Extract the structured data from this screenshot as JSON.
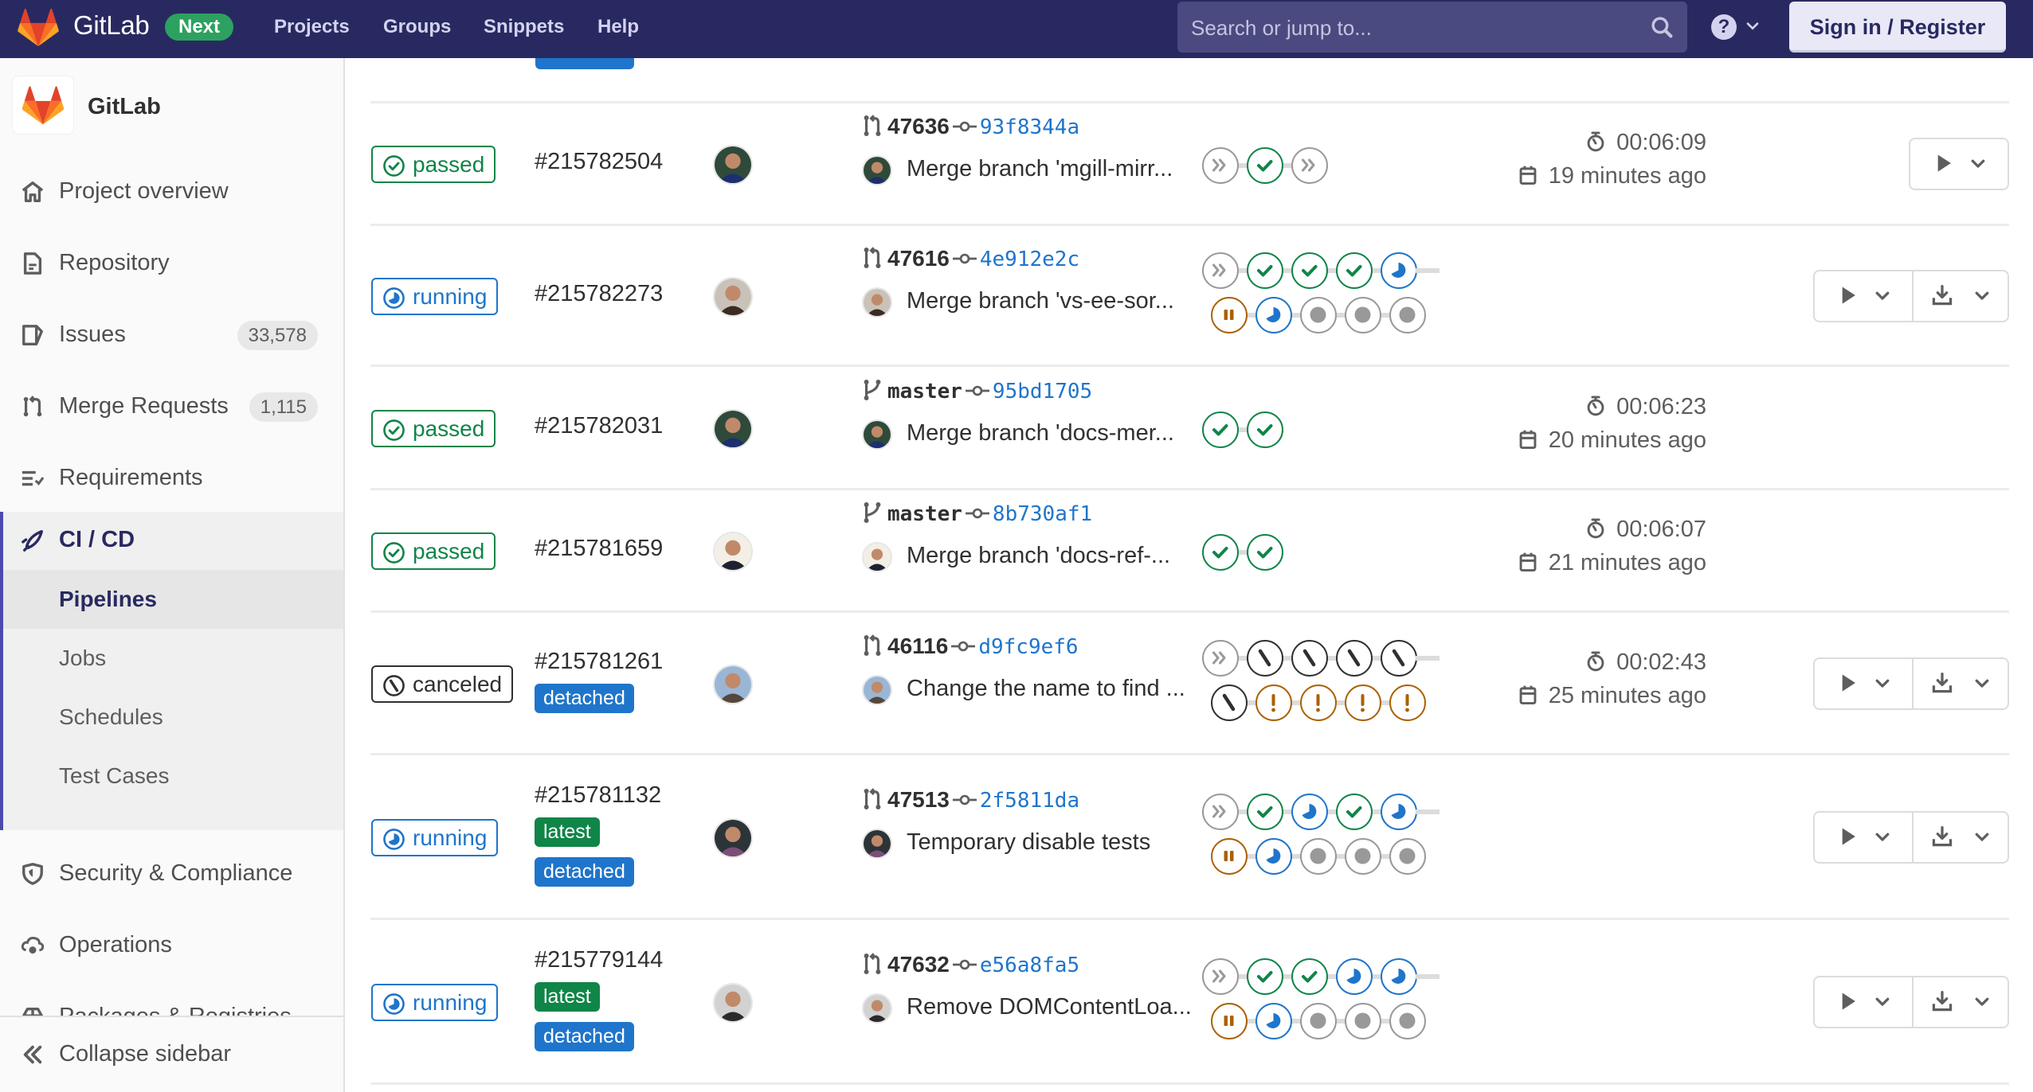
{
  "header": {
    "brand": "GitLab",
    "badge": "Next",
    "nav": [
      "Projects",
      "Groups",
      "Snippets",
      "Help"
    ],
    "search_placeholder": "Search or jump to...",
    "help_icon": "?",
    "signin_label": "Sign in / Register"
  },
  "sidebar": {
    "project_name": "GitLab",
    "items": [
      {
        "label": "Project overview",
        "icon": "home-icon"
      },
      {
        "label": "Repository",
        "icon": "document-icon"
      },
      {
        "label": "Issues",
        "icon": "issues-icon",
        "count": "33,578"
      },
      {
        "label": "Merge Requests",
        "icon": "merge-request-icon",
        "count": "1,115"
      },
      {
        "label": "Requirements",
        "icon": "requirements-icon"
      }
    ],
    "cicd": {
      "label": "CI / CD",
      "sub_items": [
        {
          "label": "Pipelines",
          "active": true
        },
        {
          "label": "Jobs"
        },
        {
          "label": "Schedules"
        },
        {
          "label": "Test Cases"
        }
      ]
    },
    "items_after": [
      {
        "label": "Security & Compliance",
        "icon": "shield-icon"
      },
      {
        "label": "Operations",
        "icon": "cloud-gear-icon"
      },
      {
        "label": "Packages & Registries",
        "icon": "package-icon"
      }
    ],
    "collapse_label": "Collapse sidebar"
  },
  "pipelines": [
    {
      "status": "passed",
      "id": "#215782504",
      "tags": [],
      "ref_type": "merge-request",
      "ref": "47636",
      "sha": "93f8344a",
      "message": "Merge branch 'mgill-mirr...",
      "stages_row1": [
        "skipped",
        "success",
        "skipped"
      ],
      "stages_row2": [],
      "duration": "00:06:09",
      "finished": "19 minutes ago",
      "actions": [
        "play"
      ]
    },
    {
      "status": "running",
      "id": "#215782273",
      "tags": [],
      "ref_type": "merge-request",
      "ref": "47616",
      "sha": "4e912e2c",
      "message": "Merge branch 'vs-ee-sor...",
      "stages_row1": [
        "skipped",
        "success",
        "success",
        "success",
        "running"
      ],
      "stages_row2": [
        "manual",
        "running",
        "created",
        "created",
        "created"
      ],
      "duration": "",
      "finished": "",
      "actions": [
        "play",
        "download"
      ]
    },
    {
      "status": "passed",
      "id": "#215782031",
      "tags": [],
      "ref_type": "branch",
      "ref": "master",
      "sha": "95bd1705",
      "message": "Merge branch 'docs-mer...",
      "stages_row1": [
        "success",
        "success"
      ],
      "stages_row2": [],
      "duration": "00:06:23",
      "finished": "20 minutes ago",
      "actions": []
    },
    {
      "status": "passed",
      "id": "#215781659",
      "tags": [],
      "ref_type": "branch",
      "ref": "master",
      "sha": "8b730af1",
      "message": "Merge branch 'docs-ref-...",
      "stages_row1": [
        "success",
        "success"
      ],
      "stages_row2": [],
      "duration": "00:06:07",
      "finished": "21 minutes ago",
      "actions": []
    },
    {
      "status": "canceled",
      "id": "#215781261",
      "tags": [
        "detached"
      ],
      "ref_type": "merge-request",
      "ref": "46116",
      "sha": "d9fc9ef6",
      "message": "Change the name to find ...",
      "stages_row1": [
        "skipped",
        "canceled",
        "canceled",
        "canceled",
        "canceled"
      ],
      "stages_row2": [
        "canceled",
        "warning",
        "warning",
        "warning",
        "warning"
      ],
      "duration": "00:02:43",
      "finished": "25 minutes ago",
      "actions": [
        "play",
        "download"
      ]
    },
    {
      "status": "running",
      "id": "#215781132",
      "tags": [
        "latest",
        "detached"
      ],
      "ref_type": "merge-request",
      "ref": "47513",
      "sha": "2f5811da",
      "message": "Temporary disable tests",
      "stages_row1": [
        "skipped",
        "success",
        "running",
        "success",
        "running"
      ],
      "stages_row2": [
        "manual",
        "running",
        "created",
        "created",
        "created"
      ],
      "duration": "",
      "finished": "",
      "actions": [
        "play",
        "download"
      ]
    },
    {
      "status": "running",
      "id": "#215779144",
      "tags": [
        "latest",
        "detached"
      ],
      "ref_type": "merge-request",
      "ref": "47632",
      "sha": "e56a8fa5",
      "message": "Remove DOMContentLoa...",
      "stages_row1": [
        "skipped",
        "success",
        "success",
        "running",
        "running"
      ],
      "stages_row2": [
        "manual",
        "running",
        "created",
        "created",
        "created"
      ],
      "duration": "",
      "finished": "",
      "actions": [
        "play",
        "download"
      ]
    }
  ],
  "colors": {
    "header_bg": "#292961",
    "success": "#108548",
    "running": "#1f75cb",
    "warning": "#ab6100",
    "neutral": "#999999",
    "canceled": "#303030"
  }
}
